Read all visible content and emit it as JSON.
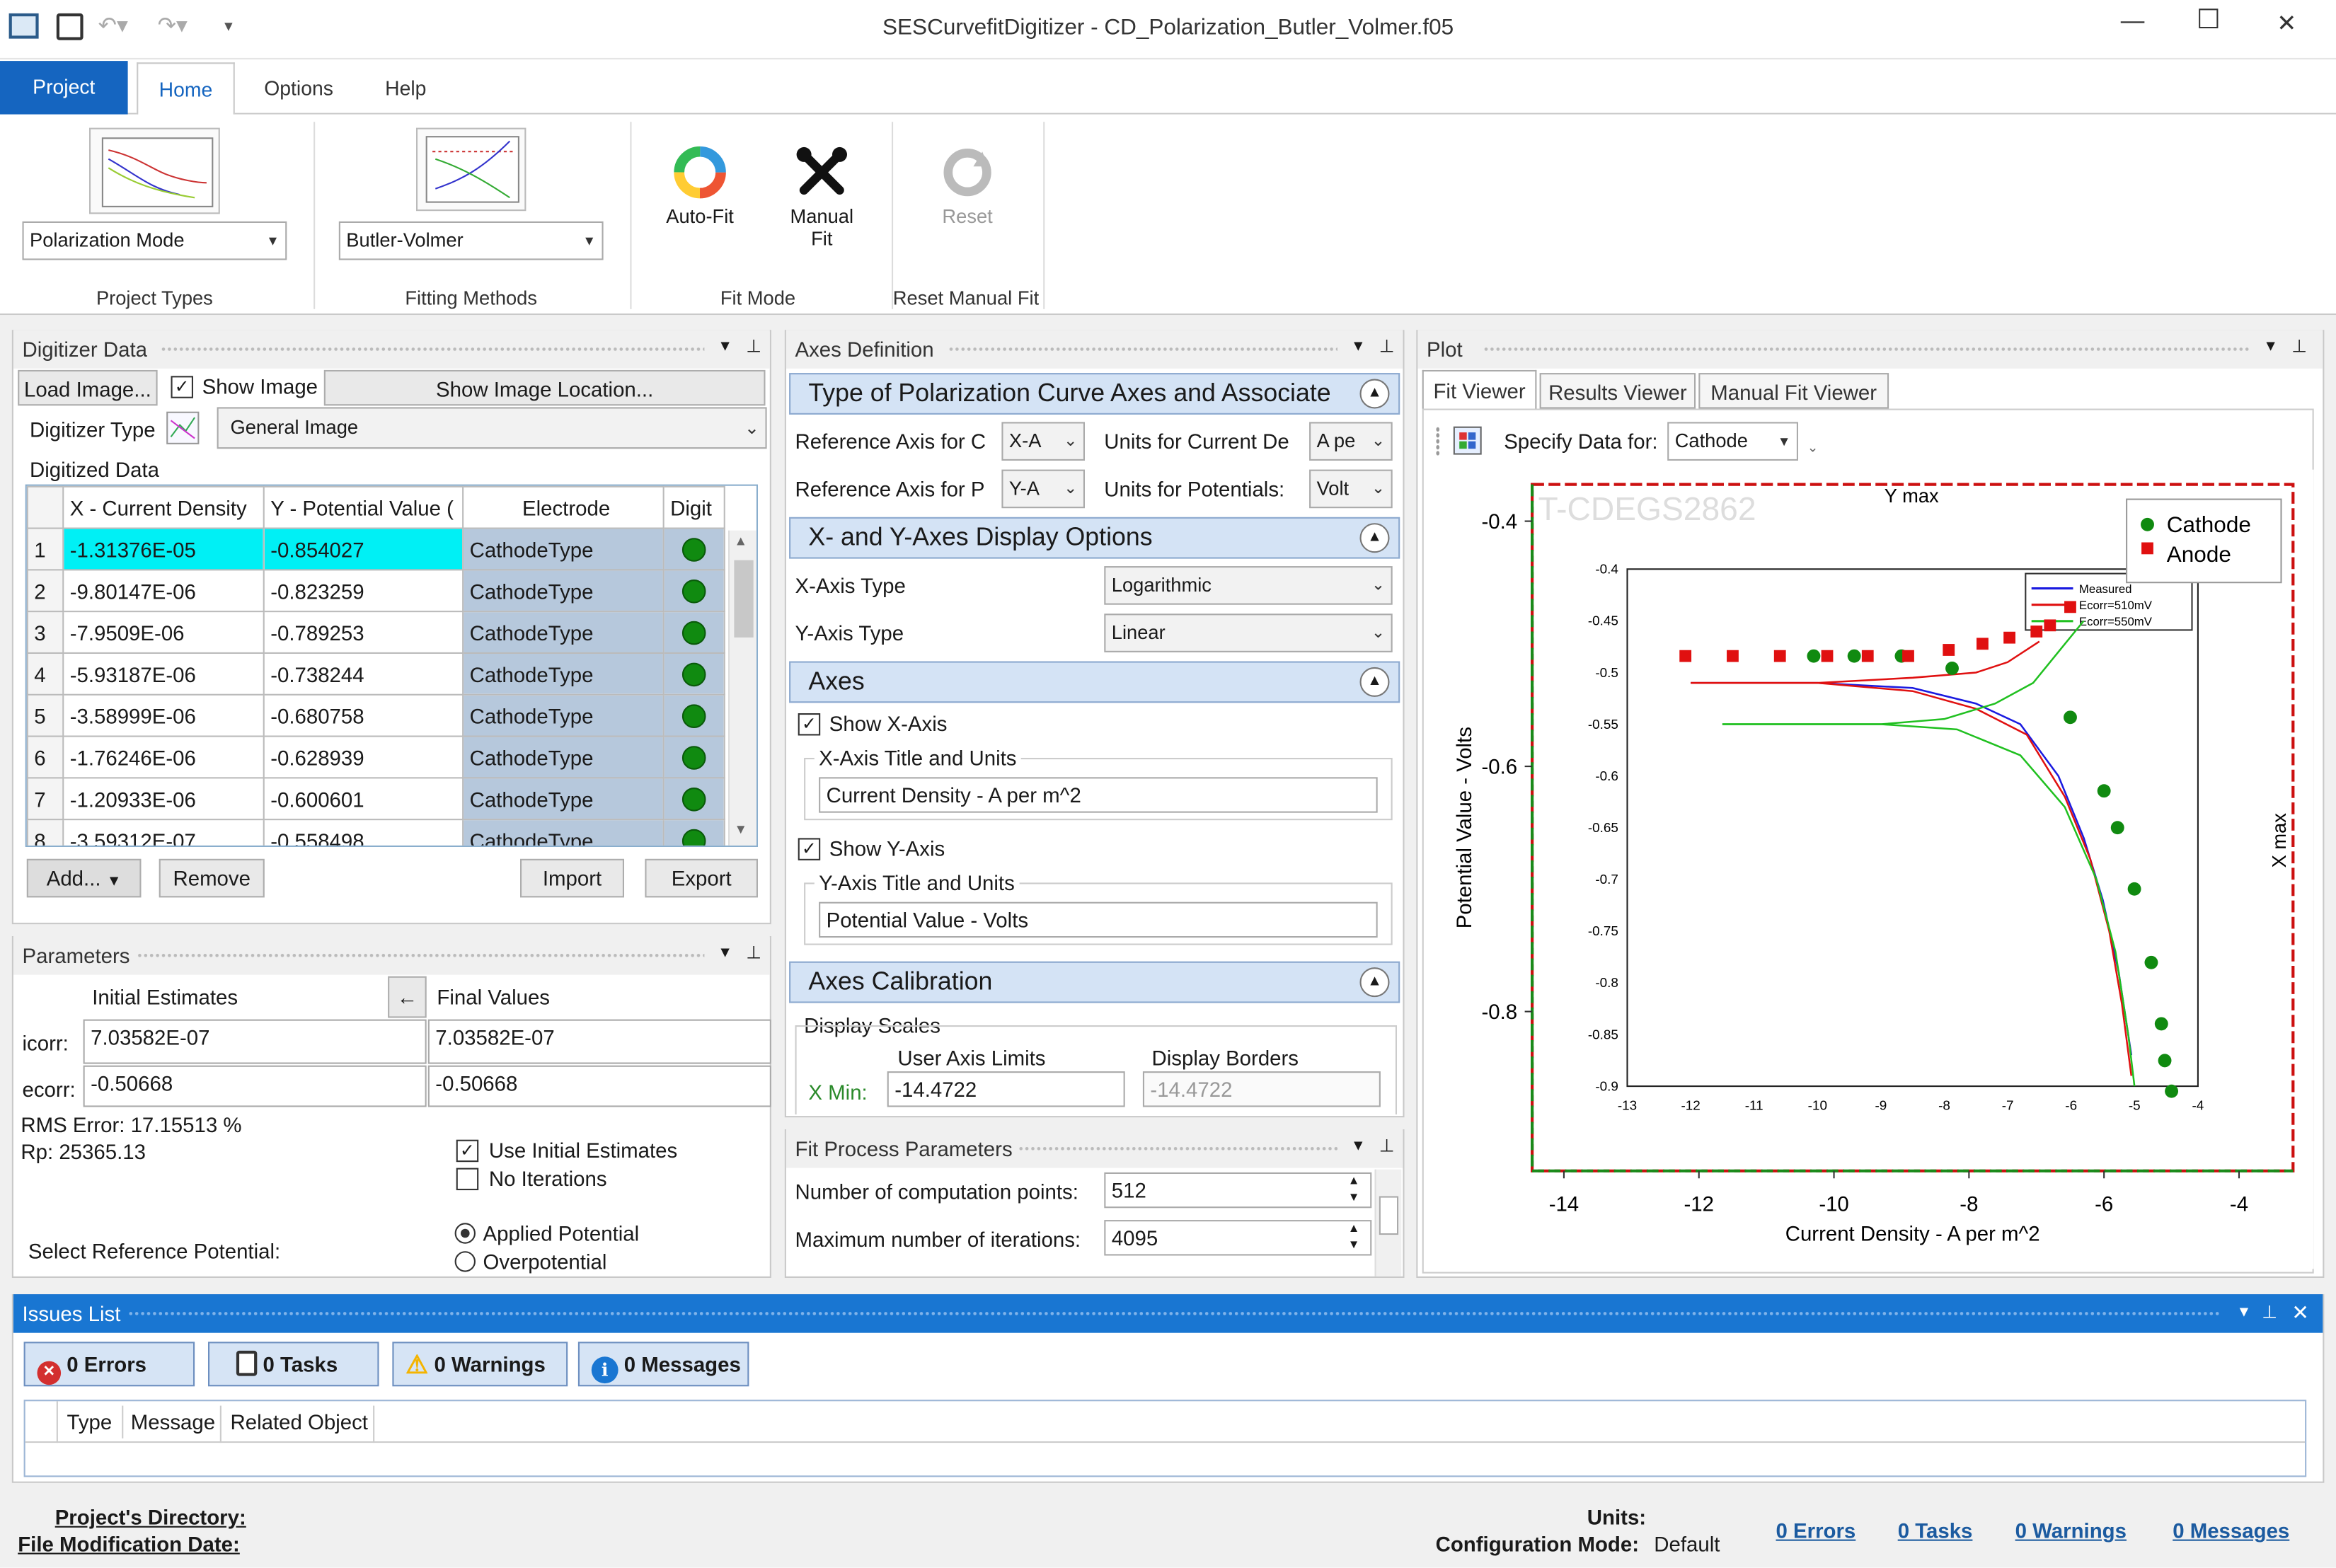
{
  "window": {
    "title": "SESCurvefitDigitizer - CD_Polarization_Butler_Volmer.f05",
    "minimize": "—",
    "maximize": "☐",
    "close": "✕"
  },
  "tabs": [
    "Project",
    "Home",
    "Options",
    "Help"
  ],
  "ribbon": {
    "project_types": {
      "value": "Polarization Mode",
      "label": "Project Types"
    },
    "fitting_methods": {
      "value": "Butler-Volmer",
      "label": "Fitting Methods"
    },
    "fit_mode": {
      "auto": "Auto-Fit",
      "manual_1": "Manual",
      "manual_2": "Fit",
      "label": "Fit Mode"
    },
    "reset": {
      "button": "Reset",
      "label": "Reset Manual Fit"
    }
  },
  "digitizer": {
    "title": "Digitizer Data",
    "load_image": "Load Image...",
    "show_image": "Show Image",
    "show_image_location": "Show Image Location...",
    "type_label": "Digitizer Type",
    "type_value": "General Image",
    "digitized_label": "Digitized Data",
    "columns": [
      "X - Current Density",
      "Y - Potential Value (",
      "Electrode",
      "Digit"
    ],
    "rows": [
      {
        "n": "1",
        "x": "-1.31376E-05",
        "y": "-0.854027",
        "e": "CathodeType"
      },
      {
        "n": "2",
        "x": "-9.80147E-06",
        "y": "-0.823259",
        "e": "CathodeType"
      },
      {
        "n": "3",
        "x": "-7.9509E-06",
        "y": "-0.789253",
        "e": "CathodeType"
      },
      {
        "n": "4",
        "x": "-5.93187E-06",
        "y": "-0.738244",
        "e": "CathodeType"
      },
      {
        "n": "5",
        "x": "-3.58999E-06",
        "y": "-0.680758",
        "e": "CathodeType"
      },
      {
        "n": "6",
        "x": "-1.76246E-06",
        "y": "-0.628939",
        "e": "CathodeType"
      },
      {
        "n": "7",
        "x": "-1.20933E-06",
        "y": "-0.600601",
        "e": "CathodeType"
      },
      {
        "n": "8",
        "x": "-3.59312E-07",
        "y": "-0.558498",
        "e": "CathodeType"
      }
    ],
    "add": "Add...",
    "remove": "Remove",
    "import": "Import",
    "export": "Export"
  },
  "parameters": {
    "title": "Parameters",
    "initial_header": "Initial Estimates",
    "final_header": "Final Values",
    "arrow": "←",
    "icorr_label": "icorr:",
    "ecorr_label": "ecorr:",
    "icorr_initial": "7.03582E-07",
    "icorr_final": "7.03582E-07",
    "ecorr_initial": "-0.50668",
    "ecorr_final": "-0.50668",
    "rms": "RMS Error: 17.15513 %",
    "rp": "Rp: 25365.13",
    "use_initial": "Use Initial Estimates",
    "no_iterations": "No Iterations",
    "ref_potential": "Select Reference Potential:",
    "applied": "Applied Potential",
    "overpotential": "Overpotential"
  },
  "axes_def": {
    "title": "Axes Definition",
    "sec1": "Type of Polarization Curve Axes and Associate",
    "ref_axis_c": "Reference Axis for C",
    "ref_axis_c_val": "X-A",
    "units_current": "Units for Current De",
    "units_current_val": "A pe",
    "ref_axis_p": "Reference Axis for P",
    "ref_axis_p_val": "Y-A",
    "units_potential": "Units for Potentials:",
    "units_potential_val": "Volt",
    "sec2": "X- and Y-Axes Display Options",
    "xaxis_type_label": "X-Axis Type",
    "xaxis_type": "Logarithmic",
    "yaxis_type_label": "Y-Axis Type",
    "yaxis_type": "Linear",
    "sec3": "Axes",
    "show_x": "Show X-Axis",
    "x_title_group": "X-Axis Title and Units",
    "x_title": "Current Density - A per m^2",
    "show_y": "Show Y-Axis",
    "y_title_group": "Y-Axis Title and Units",
    "y_title": "Potential Value - Volts",
    "sec4": "Axes Calibration",
    "display_scales": "Display Scales",
    "user_limits": "User Axis Limits",
    "display_borders": "Display Borders",
    "xmin_label": "X Min:",
    "xmin_user": "-14.4722",
    "xmin_border": "-14.4722"
  },
  "fit_process": {
    "title": "Fit Process Parameters",
    "points_label": "Number of computation points:",
    "points": "512",
    "iter_label": "Maximum number of iterations:",
    "iter": "4095"
  },
  "plot": {
    "title": "Plot",
    "tabs": [
      "Fit Viewer",
      "Results Viewer",
      "Manual Fit Viewer"
    ],
    "specify_label": "Specify Data for:",
    "specify_value": "Cathode",
    "watermark": "T-CDEGS2862",
    "ymax_label": "Y max",
    "xmax_label": "X max",
    "legend": [
      "Cathode",
      "Anode"
    ],
    "inner_legend": [
      "Measured",
      "Ecorr=510mV",
      "Ecorr=550mV"
    ]
  },
  "chart_data": [
    {
      "type": "scatter",
      "title": "",
      "xlabel": "Current Density - A per m^2",
      "ylabel": "Potential Value - Volts",
      "xlim": [
        -14.47,
        -3.2
      ],
      "ylim": [
        -0.93,
        -0.37
      ],
      "xticks": [
        "-14",
        "-12",
        "-10",
        "-8",
        "-6",
        "-4"
      ],
      "yticks": [
        "-0.4",
        "-0.6",
        "-0.8"
      ],
      "legend_position": "top-right",
      "series": [
        {
          "name": "Cathode",
          "color": "#108a10",
          "marker": "circle",
          "x": [
            -10.3,
            -9.7,
            -9.0,
            -8.25,
            -6.5,
            -6.0,
            -5.8,
            -5.55,
            -5.3,
            -5.15,
            -5.1,
            -5.0
          ],
          "y": [
            -0.51,
            -0.51,
            -0.51,
            -0.52,
            -0.56,
            -0.62,
            -0.65,
            -0.7,
            -0.76,
            -0.81,
            -0.84,
            -0.865
          ]
        },
        {
          "name": "Anode",
          "color": "#e01010",
          "marker": "square",
          "x": [
            -12.2,
            -11.5,
            -10.8,
            -10.1,
            -9.5,
            -8.9,
            -8.3,
            -7.8,
            -7.4,
            -7.0,
            -6.8,
            -6.5
          ],
          "y": [
            -0.51,
            -0.51,
            -0.51,
            -0.51,
            -0.51,
            -0.51,
            -0.505,
            -0.5,
            -0.495,
            -0.49,
            -0.485,
            -0.47
          ]
        }
      ]
    }
  ],
  "issues": {
    "title": "Issues List",
    "errors": "0 Errors",
    "tasks": "0 Tasks",
    "warnings": "0 Warnings",
    "messages": "0 Messages",
    "columns": [
      "Type",
      "Message",
      "Related Object"
    ]
  },
  "status": {
    "project_dir": "Project's Directory:",
    "file_date": "File Modification Date:",
    "units": "Units:",
    "config_label": "Configuration Mode:",
    "config_value": "Default",
    "errors": "0 Errors",
    "tasks": "0 Tasks",
    "warnings": "0 Warnings",
    "messages": "0 Messages"
  }
}
